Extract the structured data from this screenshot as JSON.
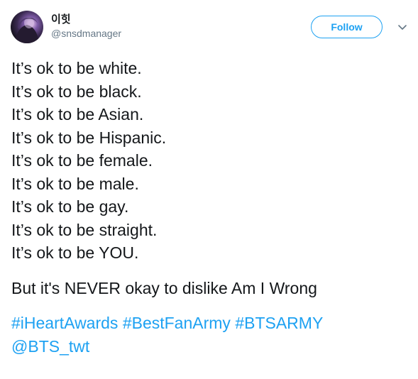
{
  "author": {
    "display_name": "이힛",
    "handle": "@snsdmanager"
  },
  "follow_button": {
    "label": "Follow"
  },
  "tweet": {
    "lines": [
      "It’s ok to be white.",
      "It’s ok to be black.",
      "It’s ok to be Asian.",
      "It’s ok to be Hispanic.",
      "It’s ok to be female.",
      "It’s ok to be male.",
      "It’s ok to be gay.",
      "It’s ok to be straight.",
      "It’s ok to be YOU."
    ],
    "closing_line": "But it's NEVER okay to dislike Am I Wrong",
    "hashtags": [
      "#iHeartAwards",
      "#BestFanArmy",
      "#BTSARMY"
    ],
    "mention": "@BTS_twt"
  },
  "colors": {
    "link_blue": "#1da1f2",
    "text_primary": "#14171a",
    "text_secondary": "#657786"
  },
  "icons": {
    "menu": "chevron-down-icon"
  }
}
